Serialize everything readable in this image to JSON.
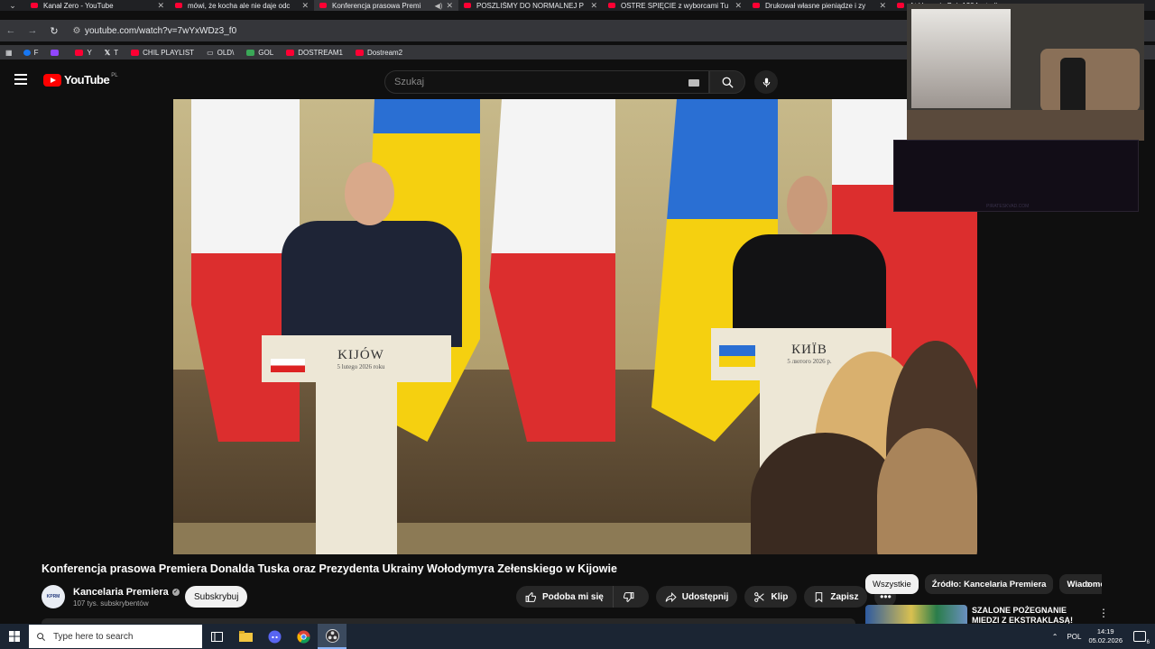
{
  "browser": {
    "tabs": [
      {
        "title": "Kanał Zero - YouTube",
        "active": false,
        "audio": false
      },
      {
        "title": "mówi, że kocha ale nie daje odc",
        "active": false,
        "audio": false
      },
      {
        "title": "Konferencja prasowa Premi",
        "active": true,
        "audio": true
      },
      {
        "title": "POSZLIŚMY DO NORMALNEJ P",
        "active": false,
        "audio": false
      },
      {
        "title": "OSTRE SPIĘCIE z wyborcami Tu",
        "active": false,
        "audio": false
      },
      {
        "title": "Drukował własne pieniądze i zy",
        "active": false,
        "audio": false
      },
      {
        "title": "At Home in Beir 1204: studi",
        "active": false,
        "audio": false
      }
    ],
    "url": "youtube.com/watch?v=7wYxWDz3_f0",
    "bookmarks": [
      {
        "label": "F",
        "color": "#1877f2"
      },
      {
        "label": "",
        "color": "#9146ff"
      },
      {
        "label": "Y",
        "color": "#ff0033"
      },
      {
        "label": "T",
        "color": "#e8eaed"
      },
      {
        "label": "CHIL PLAYLIST",
        "color": "#ff0033"
      },
      {
        "label": "OLD\\",
        "color": "#e8eaed"
      },
      {
        "label": "GOL",
        "color": "#3aa757"
      },
      {
        "label": "DOSTREAM1",
        "color": "#ff0033"
      },
      {
        "label": "Dostream2",
        "color": "#ff0033"
      }
    ]
  },
  "youtube": {
    "logo_text": "YouTube",
    "region": "PL",
    "search_placeholder": "Szukaj"
  },
  "video": {
    "left_podium_city": "KIJÓW",
    "left_podium_date": "5 lutego 2026 roku",
    "right_podium_city": "КИЇВ",
    "right_podium_date": "5 лютого 2026 р."
  },
  "overlay": {
    "watermark": "PIRATESKVAD.COM"
  },
  "watch": {
    "title": "Konferencja prasowa Premiera Donalda Tuska oraz Prezydenta Ukrainy Wołodymyra Zełenskiego w Kijowie",
    "channel_name": "Kancelaria Premiera",
    "channel_avatar_text": "KPRM",
    "subscribers": "107 tys. subskrybentów",
    "subscribe_label": "Subskrybuj",
    "like_label": "Podoba mi się",
    "share_label": "Udostępnij",
    "clip_label": "Klip",
    "save_label": "Zapisz"
  },
  "sidebar": {
    "chips": [
      "Wszystkie",
      "Źródło: Kancelaria Premiera",
      "Wiadomości"
    ],
    "selected_chip": "Wszystkie",
    "recommendation_title": "SZALONE POŻEGNANIE MIEDZI Z EKSTRAKLASĄ! ZWYCIĘSKI"
  },
  "taskbar": {
    "search_placeholder": "Type here to search",
    "language": "POL",
    "time": "14:19",
    "date": "05.02.2026",
    "notifications": "6"
  }
}
